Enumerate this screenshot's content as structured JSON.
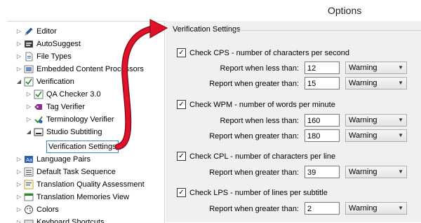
{
  "window": {
    "title": "Options"
  },
  "tree": {
    "items": [
      {
        "label": "Editor",
        "icon": "pencil-icon",
        "arrow": "▷"
      },
      {
        "label": "AutoSuggest",
        "icon": "autosuggest-icon",
        "arrow": "▷"
      },
      {
        "label": "File Types",
        "icon": "file-types-icon",
        "arrow": "▷"
      },
      {
        "label": "Embedded Content Processors",
        "icon": "embedded-content-icon",
        "arrow": "▷"
      },
      {
        "label": "Verification",
        "icon": "verification-icon",
        "arrow": "◢"
      },
      {
        "label": "QA Checker 3.0",
        "icon": "qa-checker-icon",
        "arrow": "▷"
      },
      {
        "label": "Tag Verifier",
        "icon": "tag-verifier-icon",
        "arrow": "▷"
      },
      {
        "label": "Terminology Verifier",
        "icon": "terminology-verifier-icon",
        "arrow": "▷"
      },
      {
        "label": "Studio Subtitling",
        "icon": "subtitling-icon",
        "arrow": "◢"
      },
      {
        "label": "Verification Settings",
        "icon": "",
        "arrow": ""
      },
      {
        "label": "Language Pairs",
        "icon": "language-pairs-icon",
        "arrow": "▷"
      },
      {
        "label": "Default Task Sequence",
        "icon": "task-sequence-icon",
        "arrow": "▷"
      },
      {
        "label": "Translation Quality Assessment",
        "icon": "tqa-icon",
        "arrow": "▷"
      },
      {
        "label": "Translation Memories View",
        "icon": "tm-view-icon",
        "arrow": "▷"
      },
      {
        "label": "Colors",
        "icon": "colors-icon",
        "arrow": "▷"
      },
      {
        "label": "Keyboard Shortcuts",
        "icon": "keyboard-icon",
        "arrow": "▷"
      }
    ]
  },
  "settings": {
    "header": "Verification Settings",
    "groups": [
      {
        "check_label": "Check CPS - number of characters per second",
        "checked": true,
        "rows": [
          {
            "label": "Report when less than:",
            "value": "12",
            "level": "Warning"
          },
          {
            "label": "Report when greater than:",
            "value": "15",
            "level": "Warning"
          }
        ]
      },
      {
        "check_label": "Check WPM - number of words per minute",
        "checked": true,
        "rows": [
          {
            "label": "Report when less than:",
            "value": "160",
            "level": "Warning"
          },
          {
            "label": "Report when greater than:",
            "value": "180",
            "level": "Warning"
          }
        ]
      },
      {
        "check_label": "Check CPL - number of characters per line",
        "checked": true,
        "rows": [
          {
            "label": "Report when greater than:",
            "value": "39",
            "level": "Warning"
          }
        ]
      },
      {
        "check_label": "Check LPS - number of lines per subtitle",
        "checked": true,
        "rows": [
          {
            "label": "Report when greater than:",
            "value": "2",
            "level": "Warning"
          }
        ]
      }
    ]
  },
  "colors": {
    "accent": "#3a86d9",
    "annotation_arrow": "#e0122b"
  }
}
